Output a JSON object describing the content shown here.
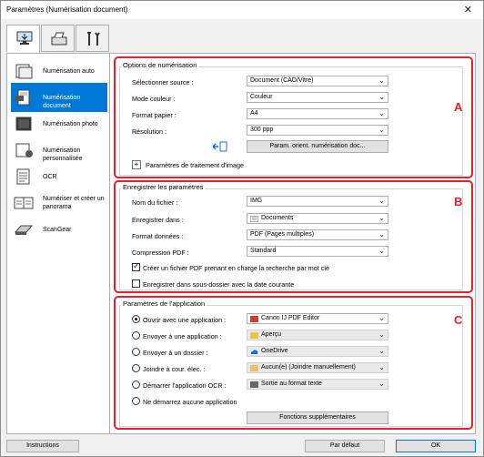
{
  "window": {
    "title": "Paramètres (Numérisation document)",
    "close": "✕"
  },
  "toptabs": [
    "scan-from-computer",
    "scan-from-operation-panel",
    "general-settings"
  ],
  "sidebar": {
    "items": [
      {
        "label": "Numérisation auto"
      },
      {
        "label": "Numérisation document"
      },
      {
        "label": "Numérisation photo"
      },
      {
        "label": "Numérisation personnalisée"
      },
      {
        "label": "OCR"
      },
      {
        "label_line1": "Numériser et créer un",
        "label_line2": "panorama"
      },
      {
        "label": "ScanGear"
      }
    ]
  },
  "scan_options": {
    "letter": "A",
    "title": "Options de numérisation",
    "source_label": "Sélectionner source :",
    "source_value": "Document (CAD/Vitre)",
    "color_label": "Mode couleur :",
    "color_value": "Couleur",
    "paper_label": "Format papier :",
    "paper_value": "A4",
    "res_label": "Résolution :",
    "res_value": "300 ppp",
    "orient_button": "Param. orient. numérisation doc...",
    "image_processing": "Paramètres de traitement d'image",
    "plus": "+"
  },
  "save_settings": {
    "letter": "B",
    "title": "Enregistrer les paramètres",
    "filename_label": "Nom du fichier :",
    "filename_value": "IMG",
    "savein_label": "Enregistrer dans :",
    "savein_value": "Documents",
    "format_label": "Format données :",
    "format_value": "PDF (Pages multiples)",
    "compression_label": "Compression PDF :",
    "compression_value": "Standard",
    "searchable_pdf": "Créer un fichier PDF prenant en charge la recherche par mot clé",
    "subfolder": "Enregistrer dans sous-dossier avec la date courante"
  },
  "app_settings": {
    "letter": "C",
    "title": "Paramètres de l'application",
    "open_app_label": "Ouvrir avec une application :",
    "open_app_value": "Canon IJ PDF Editor",
    "send_app_label": "Envoyer à une application :",
    "send_app_value": "Aperçu",
    "send_folder_label": "Envoyer à un dossier :",
    "send_folder_value": "OneDrive",
    "email_label": "Joindre à cour. élec. :",
    "email_value": "Aucun(e) (Joindre manuellement)",
    "ocr_label": "Démarrer l'application OCR :",
    "ocr_value": "Sortie au format texte",
    "none_label": "Ne démarrez aucune application",
    "more_button": "Fonctions supplémentaires"
  },
  "footer": {
    "instructions": "Instructions",
    "defaults": "Par défaut",
    "ok": "OK"
  }
}
